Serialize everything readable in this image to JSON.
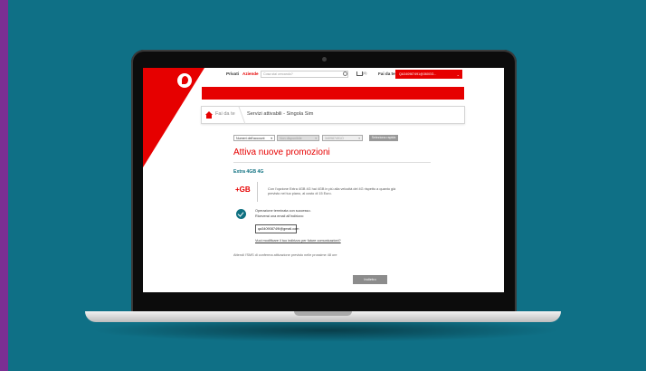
{
  "header": {
    "tabs": [
      "Privati",
      "Aziende"
    ],
    "search_placeholder": "Cosa stai cercando?",
    "cart_count": "(0)",
    "fai_da_te_label": "Fai da te",
    "account_value": "QA340987491@360GG..."
  },
  "breadcrumb": {
    "first": "Fai da te",
    "second": "Servizi attivabili - Singola Sim"
  },
  "filters": {
    "select_1": "Numeri dell'account",
    "select_2": "Non disponibile",
    "select_3": "340987491O",
    "button": "Seleziona rapida"
  },
  "main": {
    "title": "Attiva nuove promozioni",
    "offer_title": "Extra 4GB 4G",
    "badge": "+GB",
    "offer_desc": "Con l'opzione Extra 4GB 4G hai 4GB in più alla velocità del 4G rispetto a quanto già previsto nel tuo piano, al costo di 15 Euro.",
    "success_line1": "Operazione terminata con successo.",
    "success_line2": "Riceverai una email all'indirizzo:",
    "email": "qa340908749I@gmail.com",
    "email_link": "Vuoi modificare il tuo indirizzo per future comunicazioni?",
    "sms_note": "Attendi l'SMS di conferma attivazione previsto nelle prossime 48 ore",
    "back_button": "Indietro"
  },
  "colors": {
    "brand_red": "#e60000",
    "teal": "#0e7080",
    "background": "#0f7086",
    "stripe": "#7b2f93"
  }
}
